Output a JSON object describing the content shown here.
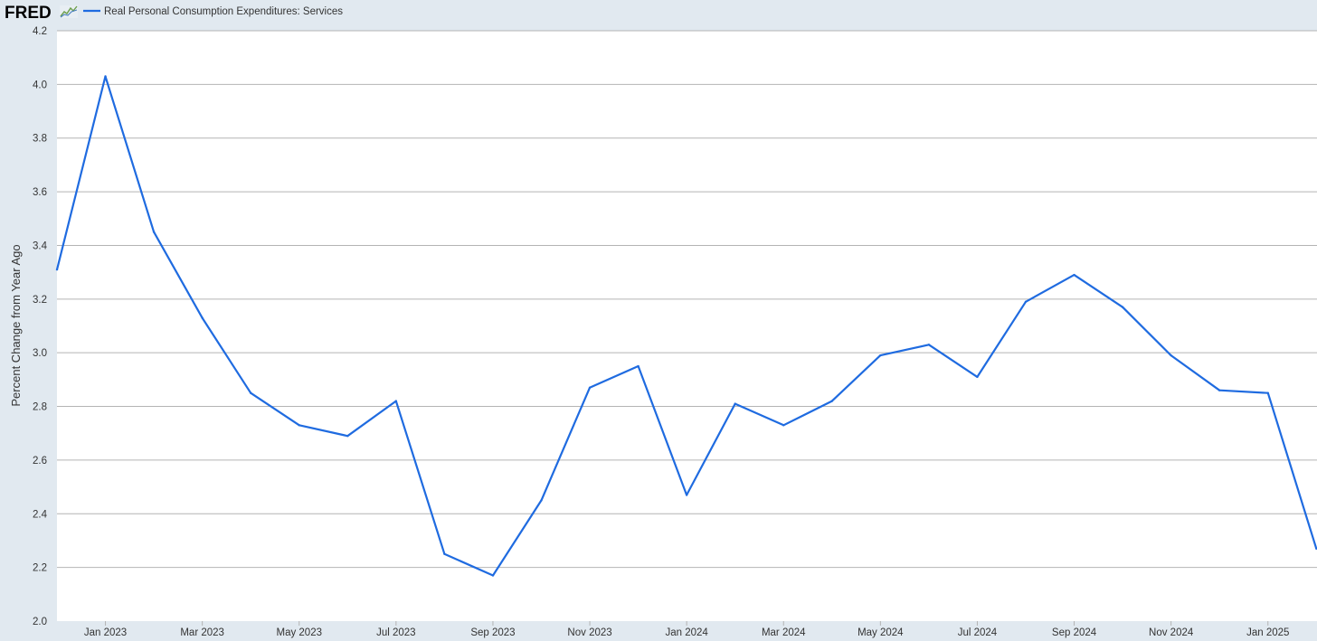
{
  "header": {
    "logo_text": "FRED",
    "legend_label": "Real Personal Consumption Expenditures: Services"
  },
  "chart_data": {
    "type": "line",
    "title": "",
    "xlabel": "",
    "ylabel": "Percent Change from Year Ago",
    "ylim": [
      2.0,
      4.2
    ],
    "yticks": [
      "2.0",
      "2.2",
      "2.4",
      "2.6",
      "2.8",
      "3.0",
      "3.2",
      "3.4",
      "3.6",
      "3.8",
      "4.0",
      "4.2"
    ],
    "xticks": [
      "Jan 2023",
      "Mar 2023",
      "May 2023",
      "Jul 2023",
      "Sep 2023",
      "Nov 2023",
      "Jan 2024",
      "Mar 2024",
      "May 2024",
      "Jul 2024",
      "Sep 2024",
      "Nov 2024",
      "Jan 2025"
    ],
    "x": [
      "2022-12",
      "2023-01",
      "2023-02",
      "2023-03",
      "2023-04",
      "2023-05",
      "2023-06",
      "2023-07",
      "2023-08",
      "2023-09",
      "2023-10",
      "2023-11",
      "2023-12",
      "2024-01",
      "2024-02",
      "2024-03",
      "2024-04",
      "2024-05",
      "2024-06",
      "2024-07",
      "2024-08",
      "2024-09",
      "2024-10",
      "2024-11",
      "2024-12",
      "2025-01",
      "2025-02"
    ],
    "series": [
      {
        "name": "Real Personal Consumption Expenditures: Services",
        "color": "#1f6be0",
        "values": [
          3.31,
          4.03,
          3.45,
          3.13,
          2.85,
          2.73,
          2.69,
          2.82,
          2.25,
          2.17,
          2.45,
          2.87,
          2.95,
          2.47,
          2.81,
          2.73,
          2.82,
          2.99,
          3.03,
          2.91,
          3.19,
          3.29,
          3.17,
          2.99,
          2.86,
          2.85,
          2.27
        ]
      }
    ],
    "grid": true,
    "legend_position": "top-left"
  },
  "colors": {
    "background": "#e1e9f0",
    "plot_background": "#ffffff",
    "gridline": "#b4b4b4",
    "line": "#1f6be0"
  }
}
